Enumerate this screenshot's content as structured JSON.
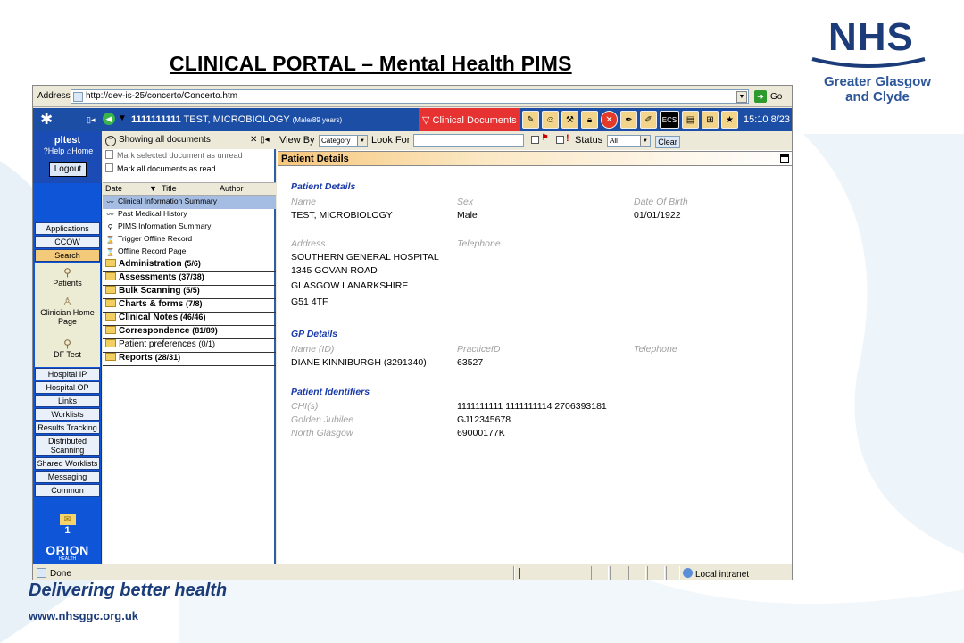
{
  "slide": {
    "title": "CLINICAL PORTAL – Mental Health PIMS",
    "logo_text": "NHS",
    "logo_sub1": "Greater Glasgow",
    "logo_sub2": "and Clyde",
    "tagline": "Delivering better health",
    "url": "www.nhsggc.org.uk",
    "colors": {
      "brand": "#1b3c79",
      "toolbar": "#1d4ea6",
      "section_heading": "#1a3aa8"
    }
  },
  "browser": {
    "address_label": "Address",
    "url": "http://dev-is-25/concerto/Concerto.htm",
    "go_label": "Go",
    "status_text": "Done",
    "zone_text": "Local intranet"
  },
  "topbar": {
    "patient_id": "1111111111",
    "patient_name": "TEST, MICROBIOLOGY",
    "patient_meta": "(Male/89 years)",
    "clinical_docs_label": "Clinical Documents",
    "ecs_label": "ECS",
    "clock": "15:10 8/23"
  },
  "sidebar": {
    "username": "pltest",
    "help_label": "Help",
    "home_label": "Home",
    "logout_label": "Logout",
    "nav_top": [
      "Applications",
      "CCOW",
      "Search"
    ],
    "nav_icons": [
      "Patients",
      "Clinician Home Page",
      "DF Test"
    ],
    "nav_bottom": [
      "Hospital IP",
      "Hospital OP",
      "Links",
      "Worklists",
      "Results Tracking",
      "Distributed Scanning",
      "Shared Worklists",
      "Messaging",
      "Common"
    ],
    "mail_count": "1",
    "brand": "ORION",
    "brand_sub": "HEALTH"
  },
  "documents": {
    "showing_label": "Showing all documents",
    "mark_unread": "Mark selected document as unread",
    "mark_read": "Mark all documents as read",
    "columns": [
      "Date",
      "Title",
      "Author"
    ],
    "docs": [
      "Clinical Information Summary",
      "Past Medical History",
      "PIMS Information Summary",
      "Trigger Offline Record",
      "Offline Record Page"
    ],
    "folders": [
      {
        "name": "Administration",
        "count": "(5/6)"
      },
      {
        "name": "Assessments",
        "count": "(37/38)"
      },
      {
        "name": "Bulk Scanning",
        "count": "(5/5)"
      },
      {
        "name": "Charts & forms",
        "count": "(7/8)"
      },
      {
        "name": "Clinical Notes",
        "count": "(46/46)"
      },
      {
        "name": "Correspondence",
        "count": "(81/89)"
      },
      {
        "name": "Patient preferences",
        "count": "(0/1)"
      },
      {
        "name": "Reports",
        "count": "(28/31)"
      }
    ]
  },
  "filter": {
    "view_by_label": "View By",
    "view_by_value": "Category",
    "look_for_label": "Look For",
    "look_for_value": "",
    "status_label": "Status",
    "status_value": "All",
    "clear_label": "Clear"
  },
  "details": {
    "panel_title": "Patient Details",
    "patient_section": "Patient Details",
    "name_label": "Name",
    "name_value": "TEST, MICROBIOLOGY",
    "sex_label": "Sex",
    "sex_value": "Male",
    "dob_label": "Date Of Birth",
    "dob_value": "01/01/1922",
    "address_label": "Address",
    "address_lines": [
      "SOUTHERN GENERAL HOSPITAL",
      "1345 GOVAN ROAD",
      "GLASGOW LANARKSHIRE",
      "G51 4TF"
    ],
    "telephone_label": "Telephone",
    "gp_section": "GP Details",
    "gp_name_label": "Name (ID)",
    "gp_name_value": "DIANE KINNIBURGH (3291340)",
    "practice_label": "PracticeID",
    "practice_value": "63527",
    "gp_tel_label": "Telephone",
    "ident_section": "Patient Identifiers",
    "identifiers": [
      {
        "label": "CHI(s)",
        "value": "1111111111 1111111114 2706393181"
      },
      {
        "label": "Golden Jubilee",
        "value": "GJ12345678"
      },
      {
        "label": "North Glasgow",
        "value": "69000177K"
      }
    ]
  }
}
